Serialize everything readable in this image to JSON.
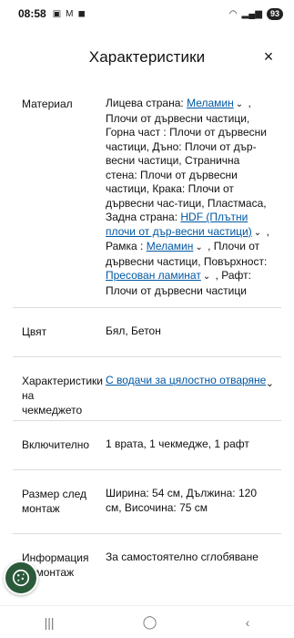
{
  "status_bar": {
    "time": "08:58",
    "battery": "93"
  },
  "header": {
    "title": "Характеристики",
    "close_label": "×"
  },
  "rows": [
    {
      "label": "Материал",
      "value_parts": {
        "p1": "Лицева страна: ",
        "link1": "Меламин",
        "p2": " , Плочи от дървесни частици, Горна част : Плочи от дървесни частици, Дъно: Плочи от дър-весни частици, Странична стена: Плочи от дървесни частици, Крака: Плочи от дървесни час-тици, Пластмаса, Задна страна: ",
        "link2": "HDF (Плътни плочи от дър-весни частици)",
        "p3": " , Рамка : ",
        "link3": "Меламин",
        "p4": " , Плочи от дървесни частици, Повърхност: ",
        "link4": "Пресован ламинат",
        "p5": " , Рафт: Плочи от дървесни частици"
      }
    },
    {
      "label": "Цвят",
      "value": "Бял, Бетон"
    },
    {
      "label": "Характеристики на чекмеджето",
      "link": "С водачи за цялостно отваряне"
    },
    {
      "label": "Включително",
      "value": "1 врата, 1 чекмедже, 1 рафт"
    },
    {
      "label": "Размер след монтаж",
      "value": "Ширина: 54 см, Дължина: 120 см, Височина: 75 см"
    },
    {
      "label": "Информация за монтаж",
      "value": "За самостоятелно сглобяване"
    }
  ],
  "nav": {
    "recent": "|||",
    "home": "◯",
    "back": "‹"
  },
  "colors": {
    "link": "#0058a3",
    "cookie_button": "#2b5a3b"
  }
}
